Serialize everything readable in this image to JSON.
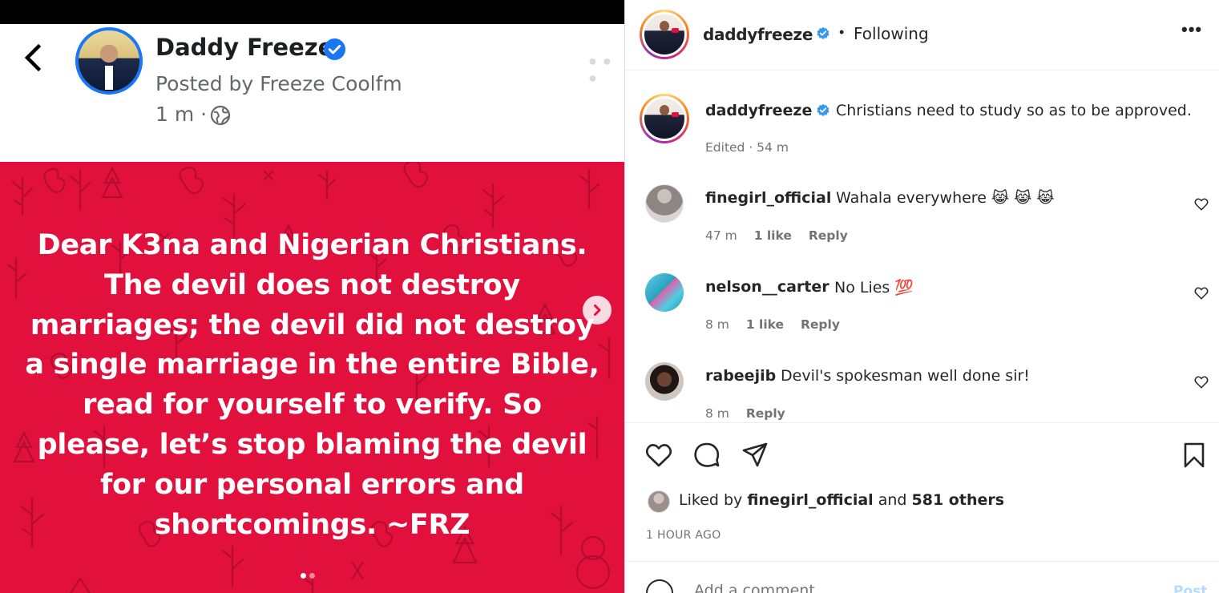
{
  "facebook_post": {
    "author_name": "Daddy Freeze",
    "posted_by": "Posted by Freeze Coolfm",
    "time": "1 m ·",
    "post_text": "Dear K3na and Nigerian Christians. The devil does not destroy marriages; the devil did not destroy a single marriage in the entire Bible, read for yourself to verify. So please, let’s stop blaming the devil for our personal errors and shortcomings. ~FRZ",
    "carousel": {
      "total": 2,
      "active": 1
    },
    "background_color": "#e1103d",
    "icons": [
      "back-arrow-icon",
      "verified-badge-icon",
      "globe-icon",
      "more-icon",
      "chevron-right-icon"
    ]
  },
  "instagram": {
    "header": {
      "username": "daddyfreeze",
      "separator": "•",
      "follow_status": "Following",
      "more": "•••"
    },
    "caption": {
      "username": "daddyfreeze",
      "text": "Christians need to study so as to be approved.",
      "meta": "Edited · 54 m"
    },
    "comments": [
      {
        "username": "finegirl_official",
        "text": "Wahala everywhere 😹 😹 😹",
        "time": "47 m",
        "likes": "1 like",
        "reply": "Reply"
      },
      {
        "username": "nelson__carter",
        "text": "No Lies 💯",
        "time": "8 m",
        "likes": "1 like",
        "reply": "Reply"
      },
      {
        "username": "rabeejib",
        "text": "Devil's spokesman well done sir!",
        "time": "8 m",
        "likes": "",
        "reply": "Reply"
      }
    ],
    "likes": {
      "prefix": "Liked by",
      "user": "finegirl_official",
      "middle": "and",
      "others": "581 others"
    },
    "time_ago": "1 HOUR AGO",
    "add_comment": {
      "placeholder": "Add a comment...",
      "post_label": "Post"
    },
    "colors": {
      "verified": "#3897f0",
      "text": "#262626",
      "muted": "#737373",
      "post_button": "#b3dbff"
    }
  }
}
